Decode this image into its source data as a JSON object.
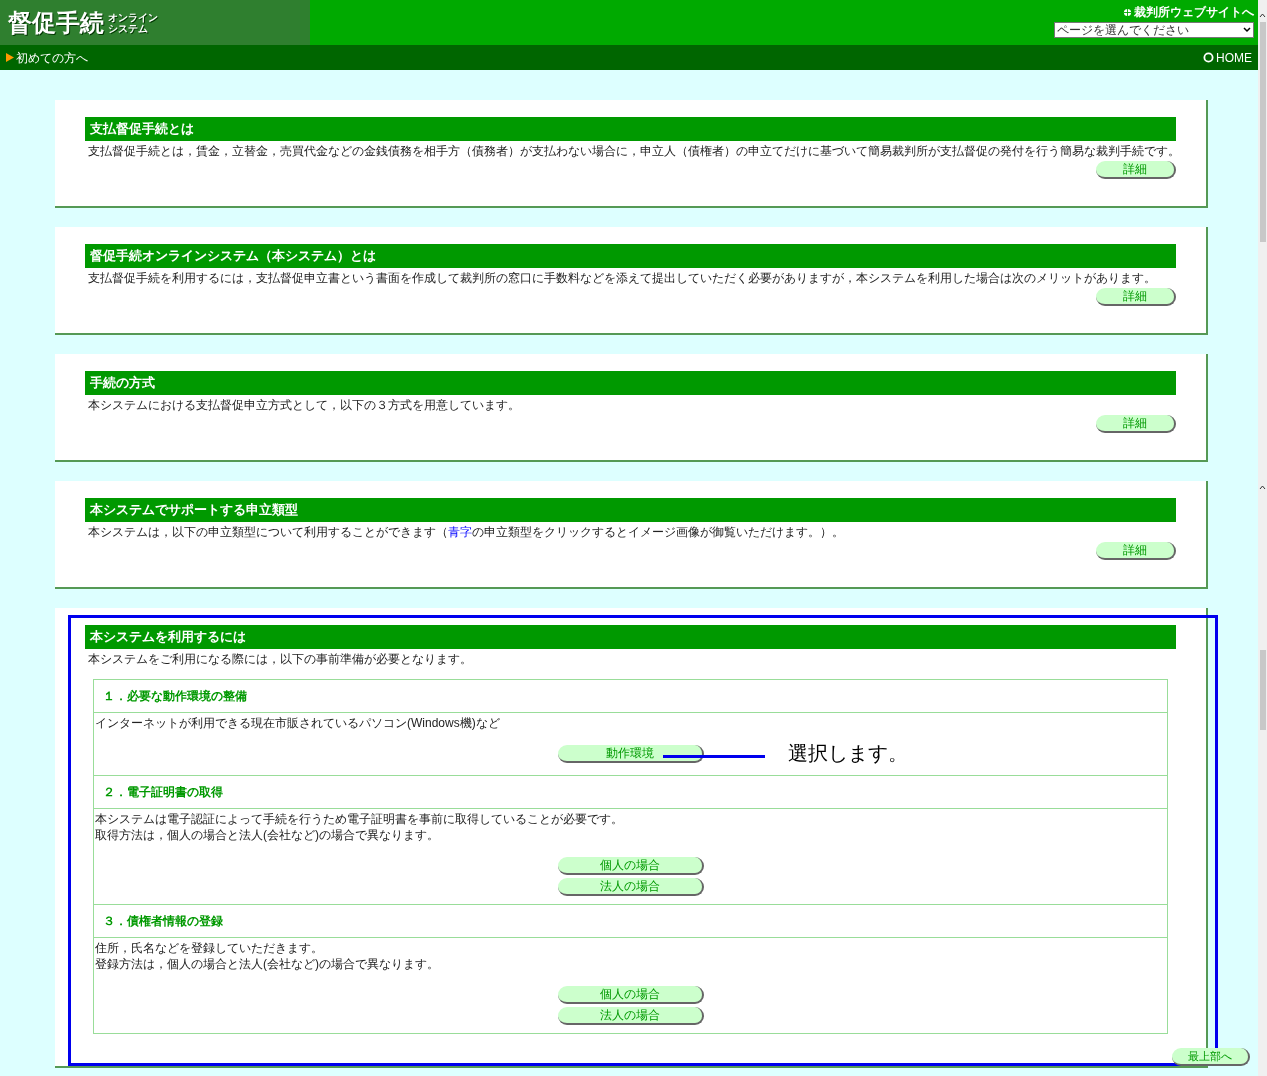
{
  "header": {
    "logo_title": "督促手続",
    "logo_subtitle": [
      "オンライン",
      "システム"
    ],
    "site_link": "裁判所ウェブサイトへ",
    "page_select": {
      "placeholder": "ページを選んでください"
    }
  },
  "nav": {
    "first_time": "初めての方へ",
    "home": "HOME"
  },
  "sections": [
    {
      "title": "支払督促手続とは",
      "parts": [
        {
          "kind": "plain",
          "text": "支払督促手続とは，賃金，立替金，売買代金などの金銭債務を相手方（債務者）が支払わない場合に，申立人（債権者）の申立てだけに基づいて簡易裁判所が支払督促の発付を行う簡易な裁判手続です。"
        }
      ],
      "button": "詳細"
    },
    {
      "title": "督促手続オンラインシステム（本システム）とは",
      "parts": [
        {
          "kind": "plain",
          "text": "支払督促手続を利用するには，支払督促申立書という書面を作成して裁判所の窓口に手数料などを添えて提出していただく必要がありますが，本システムを利用した場合は次のメリットがあります。"
        }
      ],
      "button": "詳細"
    },
    {
      "title": "手続の方式",
      "parts": [
        {
          "kind": "plain",
          "text": "本システムにおける支払督促申立方式として，以下の３方式を用意しています。"
        }
      ],
      "button": "詳細"
    },
    {
      "title": "本システムでサポートする申立類型",
      "parts": [
        {
          "kind": "plain",
          "text": "本システムは，以下の申立類型について利用することができます（"
        },
        {
          "kind": "blue",
          "text": "青字"
        },
        {
          "kind": "plain",
          "text": "の申立類型をクリックするとイメージ画像が御覧いただけます。）。"
        }
      ],
      "button": "詳細"
    }
  ],
  "usage": {
    "title": "本システムを利用するには",
    "intro": "本システムをご利用になる際には，以下の事前準備が必要となります。",
    "steps": [
      {
        "title": "１．必要な動作環境の整備",
        "lines": [
          "インターネットが利用できる現在市販されているパソコン(Windows機)など"
        ],
        "buttons": [
          "動作環境"
        ]
      },
      {
        "title": "２．電子証明書の取得",
        "lines": [
          "本システムは電子認証によって手続を行うため電子証明書を事前に取得していることが必要です。",
          "取得方法は，個人の場合と法人(会社など)の場合で異なります。"
        ],
        "buttons": [
          "個人の場合",
          "法人の場合"
        ]
      },
      {
        "title": "３．債権者情報の登録",
        "lines": [
          "住所，氏名などを登録していただきます。",
          "登録方法は，個人の場合と法人(会社など)の場合で異なります。"
        ],
        "buttons": [
          "個人の場合",
          "法人の場合"
        ]
      }
    ]
  },
  "back_to_top": "最上部へ",
  "annotation": {
    "text": "選択します。"
  }
}
